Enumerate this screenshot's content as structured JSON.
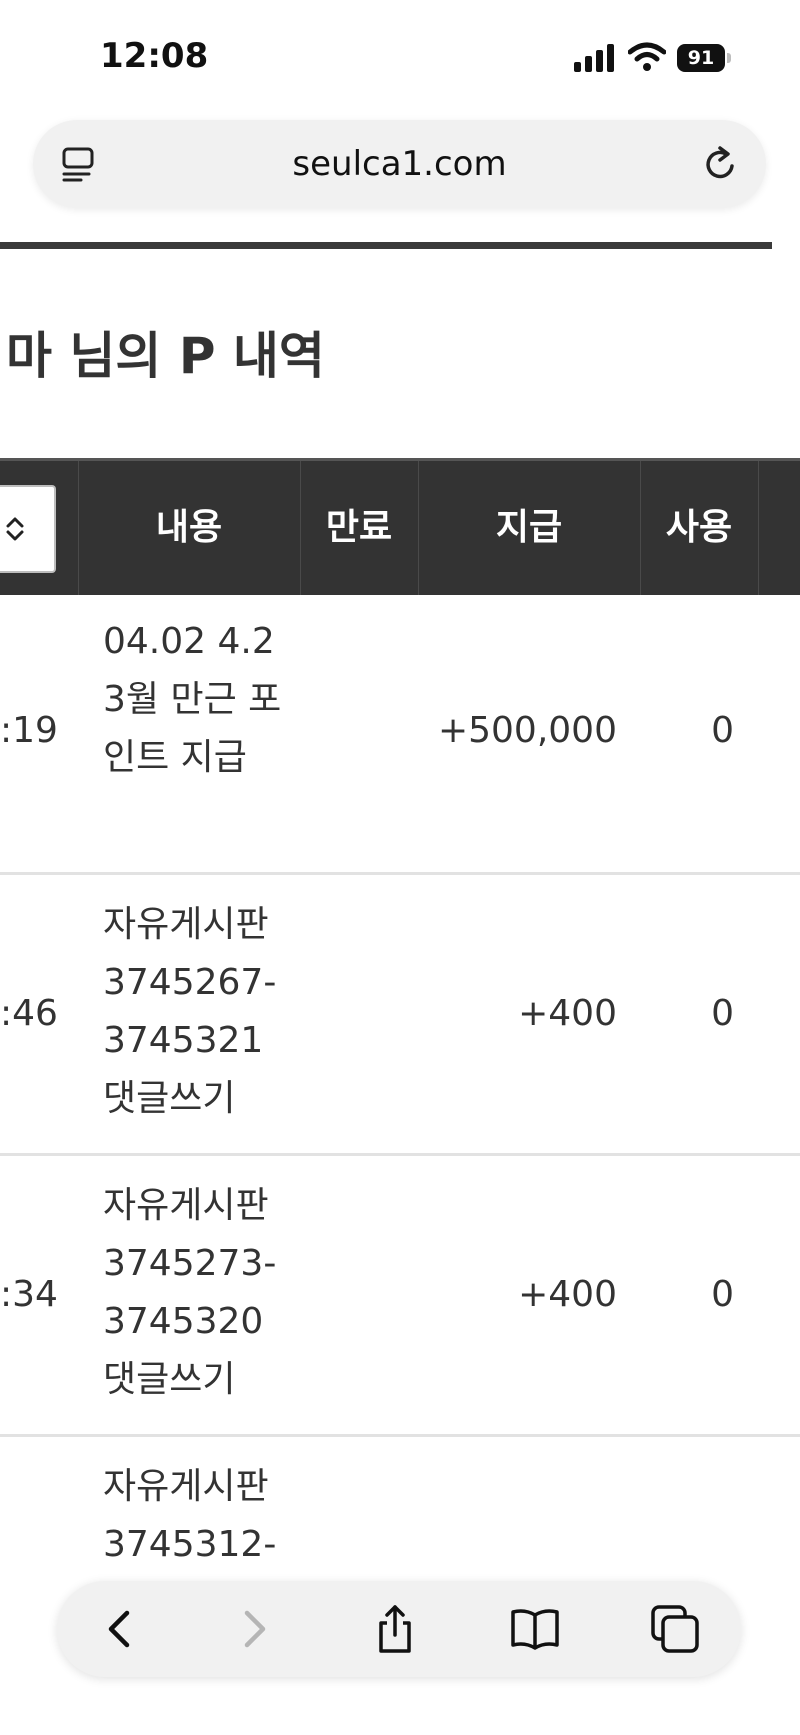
{
  "status_bar": {
    "time": "12:08",
    "battery": "91"
  },
  "browser": {
    "url": "seulca1.com"
  },
  "page": {
    "title": "마 님의 P 내역"
  },
  "table": {
    "headers": {
      "content": "내용",
      "expiry": "만료",
      "paid": "지급",
      "used": "사용"
    },
    "rows": [
      {
        "time": ":19",
        "desc": "04.02 4.23월 만근 포인트 지급",
        "paid": "+500,000",
        "used": "0"
      },
      {
        "time": ":46",
        "desc": "자유게시판 3745267-3745321 댓글쓰기",
        "paid": "+400",
        "used": "0"
      },
      {
        "time": ":34",
        "desc": "자유게시판 3745273-3745320 댓글쓰기",
        "paid": "+400",
        "used": "0"
      },
      {
        "time": "",
        "desc": "자유게시판 3745312-",
        "paid": "",
        "used": ""
      }
    ]
  },
  "icons": {
    "reader": "reader-mode-icon",
    "reload": "reload-icon",
    "back": "chevron-left-icon",
    "forward": "chevron-right-icon",
    "share": "share-icon",
    "bookmarks": "book-icon",
    "tabs": "tabs-icon"
  },
  "colors": {
    "header_bg": "#333333",
    "rule": "#3a3a3a",
    "row_border": "#e2e2e2"
  }
}
